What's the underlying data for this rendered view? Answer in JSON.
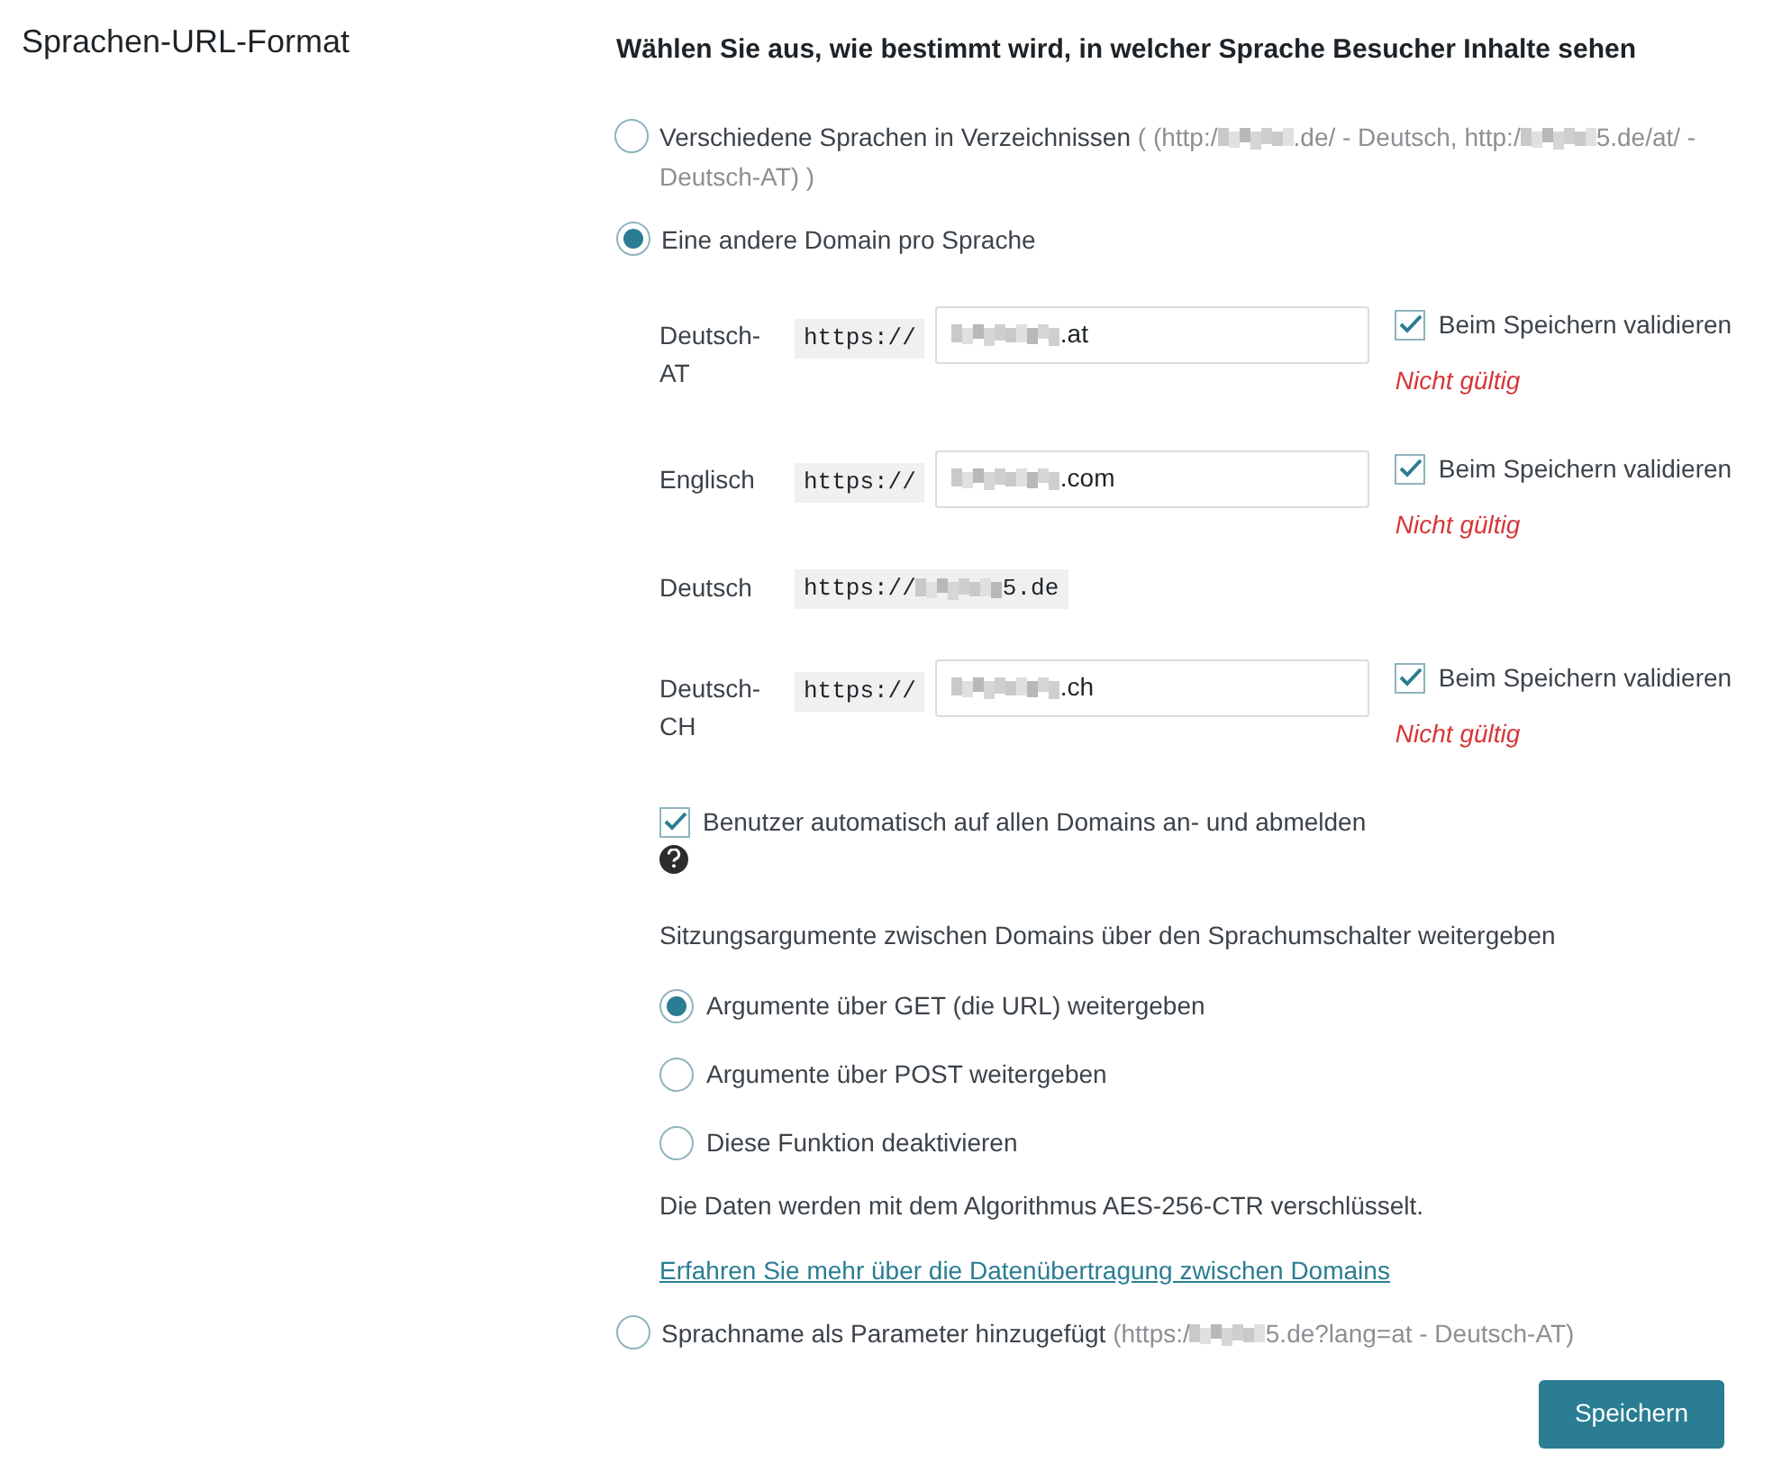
{
  "section_title": "Sprachen-URL-Format",
  "heading": "Wählen Sie aus, wie bestimmt wird, in welcher Sprache Besucher Inhalte sehen",
  "format_options": [
    {
      "label": "Verschiedene Sprachen in Verzeichnissen",
      "selected": false,
      "hint_parts": [
        {
          "kind": "text",
          "text": "( (http:/"
        },
        {
          "kind": "redacted"
        },
        {
          "kind": "text",
          "text": ".de/ - Deutsch, http:/"
        },
        {
          "kind": "redacted"
        },
        {
          "kind": "text",
          "text": "5.de/at/ - Deutsch-AT) )"
        }
      ]
    },
    {
      "label": "Eine andere Domain pro Sprache",
      "selected": true,
      "domains": [
        {
          "kind": "editable",
          "language": "Deutsch-AT",
          "prefix": "https://",
          "value_suffix": ".at",
          "validate": {
            "label": "Beim Speichern validieren",
            "checked": true
          },
          "error": "Nicht gültig"
        },
        {
          "kind": "editable",
          "language": "Englisch",
          "prefix": "https://",
          "value_suffix": ".com",
          "validate": {
            "label": "Beim Speichern validieren",
            "checked": true
          },
          "error": "Nicht gültig"
        },
        {
          "kind": "static",
          "language": "Deutsch",
          "prefix": "https://",
          "value_suffix": "5.de"
        },
        {
          "kind": "editable",
          "language": "Deutsch-CH",
          "prefix": "https://",
          "value_suffix": ".ch",
          "validate": {
            "label": "Beim Speichern validieren",
            "checked": true
          },
          "error": "Nicht gültig"
        }
      ],
      "auto_login": {
        "label": "Benutzer automatisch auf allen Domains an- und abmelden",
        "checked": true
      },
      "session_heading": "Sitzungsargumente zwischen Domains über den Sprachumschalter weitergeben",
      "session_options": [
        {
          "label": "Argumente über GET (die URL) weitergeben",
          "selected": true
        },
        {
          "label": "Argumente über POST weitergeben",
          "selected": false
        },
        {
          "label": "Diese Funktion deaktivieren",
          "selected": false
        }
      ],
      "encryption_note": "Die Daten werden mit dem Algorithmus AES-256-CTR verschlüsselt.",
      "learn_more_link": "Erfahren Sie mehr über die Datenübertragung zwischen Domains"
    },
    {
      "label": "Sprachname als Parameter hinzugefügt",
      "selected": false,
      "hint_parts": [
        {
          "kind": "text",
          "text": "(https:/"
        },
        {
          "kind": "redacted"
        },
        {
          "kind": "text",
          "text": "5.de?lang=at - Deutsch-AT)"
        }
      ]
    }
  ],
  "save_button": "Speichern"
}
